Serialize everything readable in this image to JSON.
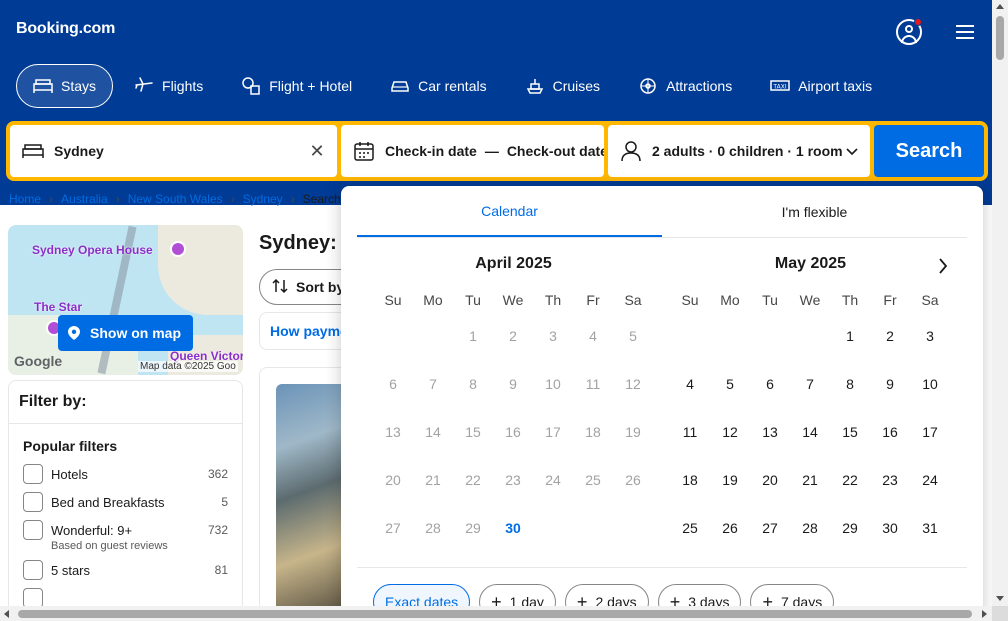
{
  "header": {
    "logo": "Booking.com",
    "nav": [
      {
        "label": "Stays",
        "icon": "bed-icon",
        "active": true
      },
      {
        "label": "Flights",
        "icon": "plane-icon"
      },
      {
        "label": "Flight + Hotel",
        "icon": "flight-hotel-icon"
      },
      {
        "label": "Car rentals",
        "icon": "car-icon"
      },
      {
        "label": "Cruises",
        "icon": "ship-icon"
      },
      {
        "label": "Attractions",
        "icon": "attractions-icon"
      },
      {
        "label": "Airport taxis",
        "icon": "taxi-icon"
      }
    ]
  },
  "search": {
    "destination": "Sydney",
    "checkin_label": "Check-in date",
    "dash": "—",
    "checkout_label": "Check-out date",
    "guests": "2 adults · 0 children · 1 room",
    "button": "Search"
  },
  "breadcrumb": {
    "items": [
      "Home",
      "Australia",
      "New South Wales",
      "Sydney"
    ],
    "current": "Search"
  },
  "map": {
    "labels": [
      "Sydney Opera House",
      "The Star",
      "Queen Victoria B"
    ],
    "show_map": "Show on map",
    "google": "Google",
    "attribution": "Map data ©2025 Goo"
  },
  "filter": {
    "title": "Filter by:",
    "section": "Popular filters",
    "items": [
      {
        "name": "Hotels",
        "count": "362"
      },
      {
        "name": "Bed and Breakfasts",
        "count": "5"
      },
      {
        "name": "Wonderful: 9+",
        "count": "732",
        "note": "Based on guest reviews"
      },
      {
        "name": "5 stars",
        "count": "81"
      }
    ]
  },
  "results": {
    "title": "Sydney:",
    "sort": "Sort by",
    "payment": "How payme"
  },
  "calendar": {
    "tabs": [
      "Calendar",
      "I'm flexible"
    ],
    "weekdays": [
      "Su",
      "Mo",
      "Tu",
      "We",
      "Th",
      "Fr",
      "Sa"
    ],
    "months": [
      {
        "title": "April 2025",
        "offset": 2,
        "days": 30,
        "past_until": 29,
        "today": 30
      },
      {
        "title": "May 2025",
        "offset": 4,
        "days": 31,
        "past_until": 0,
        "today": 0
      }
    ],
    "chips": [
      {
        "label": "Exact dates",
        "plus": false,
        "active": true
      },
      {
        "label": "1 day",
        "plus": true
      },
      {
        "label": "2 days",
        "plus": true
      },
      {
        "label": "3 days",
        "plus": true
      },
      {
        "label": "7 days",
        "plus": true
      }
    ]
  },
  "colors": {
    "brand": "#003b95",
    "accent": "#006ce4",
    "search_border": "#ffb700"
  }
}
